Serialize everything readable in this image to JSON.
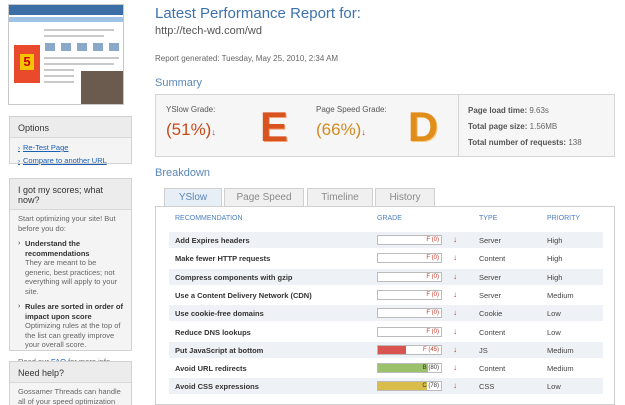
{
  "sidebar": {
    "options": {
      "title": "Options",
      "links": [
        "Re-Test Page",
        "Compare to another URL"
      ]
    },
    "scores": {
      "title": "I got my scores; what now?",
      "intro": "Start optimizing your site! But before you do:",
      "items": [
        {
          "heading": "Understand the recommendations",
          "text": "They are meant to be generic, best practices; not everything will apply to your site."
        },
        {
          "heading": "Rules are sorted in order of impact upon score",
          "text": "Optimizing rules at the top of the list can greatly improve your overall score."
        }
      ],
      "read_prefix": "Read our",
      "read_link": "FAQ",
      "read_suffix": "for more info."
    },
    "help": {
      "title": "Need help?",
      "text": "Gossamer Threads can handle all of your speed optimization"
    }
  },
  "report": {
    "title": "Latest Performance Report for:",
    "url": "http://tech-wd.com/wd",
    "generated": "Report generated: Tuesday, May 25, 2010, 2:34 AM"
  },
  "summary": {
    "heading": "Summary",
    "yslow": {
      "label": "YSlow Grade:",
      "percent": "(51%)",
      "letter": "E"
    },
    "pagespeed": {
      "label": "Page Speed Grade:",
      "percent": "(66%)",
      "letter": "D"
    },
    "stats": [
      {
        "label": "Page load time:",
        "value": "9.63s"
      },
      {
        "label": "Total page size:",
        "value": "1.56MB"
      },
      {
        "label": "Total number of requests:",
        "value": "138"
      }
    ]
  },
  "breakdown": {
    "heading": "Breakdown",
    "tabs": [
      "YSlow",
      "Page Speed",
      "Timeline",
      "History"
    ],
    "columns": [
      "RECOMMENDATION",
      "GRADE",
      "TYPE",
      "PRIORITY"
    ],
    "rows": [
      {
        "rec": "Add Expires headers",
        "grade": "F (0)",
        "score": 0,
        "color": "#d9534f",
        "type": "Server",
        "priority": "High"
      },
      {
        "rec": "Make fewer HTTP requests",
        "grade": "F (0)",
        "score": 0,
        "color": "#d9534f",
        "type": "Content",
        "priority": "High"
      },
      {
        "rec": "Compress components with gzip",
        "grade": "F (0)",
        "score": 0,
        "color": "#d9534f",
        "type": "Server",
        "priority": "High"
      },
      {
        "rec": "Use a Content Delivery Network (CDN)",
        "grade": "F (0)",
        "score": 0,
        "color": "#d9534f",
        "type": "Server",
        "priority": "Medium"
      },
      {
        "rec": "Use cookie-free domains",
        "grade": "F (0)",
        "score": 0,
        "color": "#d9534f",
        "type": "Cookie",
        "priority": "Low"
      },
      {
        "rec": "Reduce DNS lookups",
        "grade": "F (0)",
        "score": 0,
        "color": "#d9534f",
        "type": "Content",
        "priority": "Low"
      },
      {
        "rec": "Put JavaScript at bottom",
        "grade": "F (45)",
        "score": 45,
        "color": "#d9534f",
        "type": "JS",
        "priority": "Medium"
      },
      {
        "rec": "Avoid URL redirects",
        "grade": "B (80)",
        "score": 80,
        "color": "#9bc26b",
        "type": "Content",
        "priority": "Medium"
      },
      {
        "rec": "Avoid CSS expressions",
        "grade": "C (78)",
        "score": 78,
        "color": "#d9bd4a",
        "type": "CSS",
        "priority": "Low"
      }
    ]
  }
}
